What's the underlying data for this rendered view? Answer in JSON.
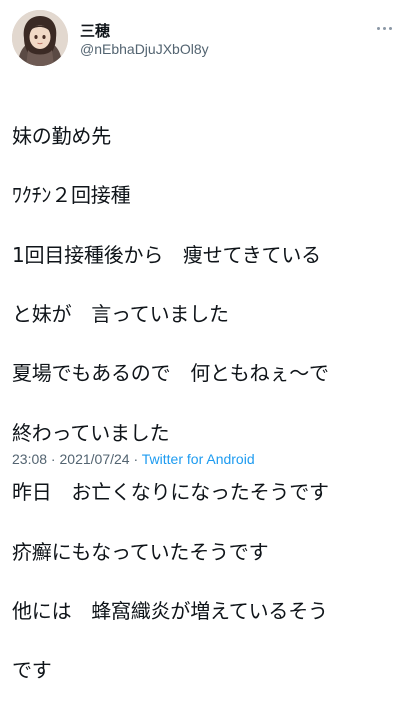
{
  "tweet": {
    "author": {
      "display_name": "三穂",
      "handle": "@nEbhaDjuJXbOl8y",
      "avatar": "avatar-illustration"
    },
    "more_icon": "more-horizontal-icon",
    "text_lines": [
      "妹の勤め先",
      "ﾜｸﾁﾝ２回接種",
      "1回目接種後から　痩せてきている",
      "と妹が　言っていました",
      "夏場でもあるので　何ともねぇ〜で",
      "終わっていました",
      "昨日　お亡くなりになったそうです",
      "疥癬にもなっていたそうです",
      "他には　蜂窩織炎が増えているそう",
      "です"
    ],
    "time": "23:08",
    "separator": " · ",
    "date": "2021/07/24",
    "source": "Twitter for Android"
  },
  "colors": {
    "text": "#0f1419",
    "secondary": "#536471",
    "link": "#1d9bf0"
  }
}
